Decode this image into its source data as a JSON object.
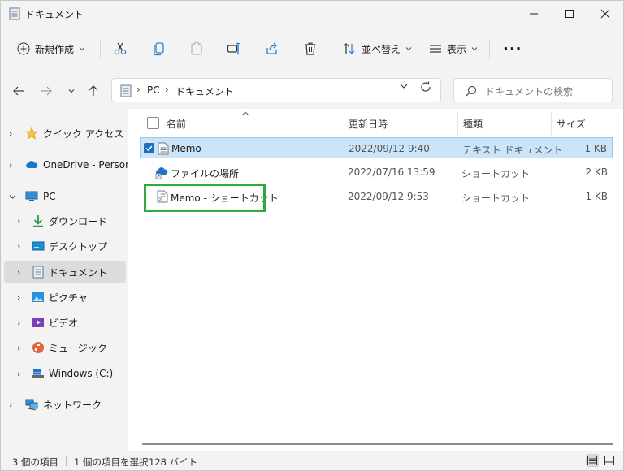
{
  "window": {
    "title": "ドキュメント",
    "title_icon": "document-folder-icon"
  },
  "toolbar": {
    "new_label": "新規作成",
    "sort_label": "並べ替え",
    "view_label": "表示",
    "more_label": "···"
  },
  "address": {
    "crumbs": [
      "PC",
      "ドキュメント"
    ],
    "search_placeholder": "ドキュメントの検索"
  },
  "nav": {
    "items": [
      {
        "label": "クイック アクセス",
        "icon": "star-icon",
        "level": 0,
        "expanded": false
      },
      {
        "label": "OneDrive - Personal",
        "icon": "cloud-icon",
        "level": 0,
        "expanded": false
      },
      {
        "label": "PC",
        "icon": "monitor-icon",
        "level": 0,
        "expanded": true
      },
      {
        "label": "ダウンロード",
        "icon": "download-icon",
        "level": 1,
        "expanded": false
      },
      {
        "label": "デスクトップ",
        "icon": "desktop-icon",
        "level": 1,
        "expanded": false
      },
      {
        "label": "ドキュメント",
        "icon": "document-icon",
        "level": 1,
        "expanded": false,
        "selected": true
      },
      {
        "label": "ピクチャ",
        "icon": "pictures-icon",
        "level": 1,
        "expanded": false
      },
      {
        "label": "ビデオ",
        "icon": "video-icon",
        "level": 1,
        "expanded": false
      },
      {
        "label": "ミュージック",
        "icon": "music-icon",
        "level": 1,
        "expanded": false
      },
      {
        "label": "Windows (C:)",
        "icon": "drive-icon",
        "level": 1,
        "expanded": false
      },
      {
        "label": "ネットワーク",
        "icon": "network-icon",
        "level": 0,
        "expanded": false
      }
    ]
  },
  "files": {
    "columns": [
      "名前",
      "更新日時",
      "種類",
      "サイズ"
    ],
    "rows": [
      {
        "name": "Memo",
        "date": "2022/09/12 9:40",
        "type": "テキスト ドキュメント",
        "size": "1 KB",
        "icon": "text-file-icon",
        "selected": true
      },
      {
        "name": "ファイルの場所",
        "date": "2022/07/16 13:59",
        "type": "ショートカット",
        "size": "2 KB",
        "icon": "cloud-shortcut-icon",
        "selected": false
      },
      {
        "name": "Memo - ショートカット",
        "date": "2022/09/12 9:53",
        "type": "ショートカット",
        "size": "1 KB",
        "icon": "text-shortcut-icon",
        "selected": false
      }
    ]
  },
  "status": {
    "item_count": "3 個の項目",
    "selection": "1 個の項目を選択",
    "selection_size": "128 バイト"
  },
  "colors": {
    "selection_bg": "#cce4f7",
    "highlight_box": "#2eaa3e",
    "nav_selected": "#dcdcdc"
  }
}
